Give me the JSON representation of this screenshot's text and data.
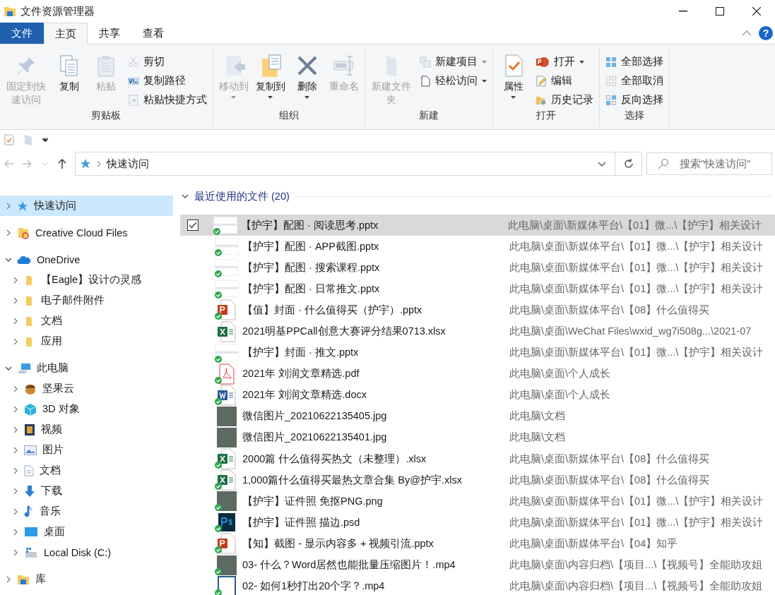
{
  "window": {
    "title": "文件资源管理器"
  },
  "ribbon": {
    "tabs": [
      {
        "label": "文件",
        "kind": "file",
        "selected": false
      },
      {
        "label": "主页",
        "kind": "tab",
        "selected": true
      },
      {
        "label": "共享",
        "kind": "tab",
        "selected": false
      },
      {
        "label": "查看",
        "kind": "tab",
        "selected": false
      }
    ],
    "help": "?",
    "groups": [
      {
        "label": "剪贴板",
        "items": [
          {
            "kind": "large",
            "label": "固定到快速访问",
            "disabled": true,
            "dropdown": false
          },
          {
            "kind": "large",
            "label": "复制",
            "disabled": false,
            "dropdown": false
          },
          {
            "kind": "large",
            "label": "粘贴",
            "disabled": true,
            "dropdown": false
          },
          {
            "kind": "small",
            "label": "剪切",
            "disabled": true,
            "dropdown": false
          },
          {
            "kind": "small",
            "label": "复制路径",
            "disabled": false,
            "dropdown": false
          },
          {
            "kind": "small",
            "label": "粘贴快捷方式",
            "disabled": true,
            "dropdown": false
          }
        ]
      },
      {
        "label": "组织",
        "items": [
          {
            "kind": "large",
            "label": "移动到",
            "disabled": true,
            "dropdown": true
          },
          {
            "kind": "large",
            "label": "复制到",
            "disabled": false,
            "dropdown": true
          },
          {
            "kind": "large",
            "label": "删除",
            "disabled": false,
            "dropdown": true
          },
          {
            "kind": "large",
            "label": "重命名",
            "disabled": true,
            "dropdown": false
          }
        ]
      },
      {
        "label": "新建",
        "items": [
          {
            "kind": "large",
            "label": "新建文件夹",
            "disabled": true,
            "dropdown": false
          },
          {
            "kind": "small",
            "label": "新建项目",
            "disabled": true,
            "dropdown": true
          },
          {
            "kind": "small",
            "label": "轻松访问",
            "disabled": false,
            "dropdown": true
          }
        ]
      },
      {
        "label": "打开",
        "items": [
          {
            "kind": "large",
            "label": "属性",
            "disabled": false,
            "dropdown": true
          },
          {
            "kind": "small",
            "label": "打开",
            "disabled": false,
            "dropdown": true
          },
          {
            "kind": "small",
            "label": "编辑",
            "disabled": false,
            "dropdown": false
          },
          {
            "kind": "small",
            "label": "历史记录",
            "disabled": false,
            "dropdown": false
          }
        ]
      },
      {
        "label": "选择",
        "items": [
          {
            "kind": "small",
            "label": "全部选择",
            "disabled": false,
            "dropdown": false
          },
          {
            "kind": "small",
            "label": "全部取消",
            "disabled": false,
            "dropdown": false
          },
          {
            "kind": "small",
            "label": "反向选择",
            "disabled": false,
            "dropdown": false
          }
        ]
      }
    ]
  },
  "address_bar": {
    "path": "快速访问",
    "search": {
      "placeholder": "搜索\"快速访问\""
    }
  },
  "sidebar": {
    "items": [
      {
        "label": "快速访问",
        "expanded": false,
        "selected": true
      },
      {
        "label": "Creative Cloud Files",
        "expanded": false,
        "selected": false
      },
      {
        "label": "OneDrive",
        "expanded": true,
        "selected": false,
        "children": [
          {
            "label": "【Eagle】设计の灵感",
            "expanded": false,
            "selected": false
          },
          {
            "label": "电子邮件附件",
            "expanded": false,
            "selected": false
          },
          {
            "label": "文档",
            "expanded": false,
            "selected": false
          },
          {
            "label": "应用",
            "expanded": false,
            "selected": false
          }
        ]
      },
      {
        "label": "此电脑",
        "expanded": true,
        "selected": false,
        "children": [
          {
            "label": "坚果云",
            "expanded": false,
            "selected": false
          },
          {
            "label": "3D 对象",
            "expanded": false,
            "selected": false
          },
          {
            "label": "视频",
            "expanded": false,
            "selected": false
          },
          {
            "label": "图片",
            "expanded": false,
            "selected": false
          },
          {
            "label": "文档",
            "expanded": false,
            "selected": false
          },
          {
            "label": "下载",
            "expanded": false,
            "selected": false
          },
          {
            "label": "音乐",
            "expanded": false,
            "selected": false
          },
          {
            "label": "桌面",
            "expanded": false,
            "selected": false
          },
          {
            "label": "Local Disk (C:)",
            "expanded": false,
            "selected": false
          }
        ]
      },
      {
        "label": "库",
        "expanded": false,
        "selected": false
      }
    ]
  },
  "recent": {
    "title": "最近使用的文件 (20)",
    "expanded": true,
    "files": [
      {
        "name": "【护宇】配图 · 阅读思考.pptx",
        "path": "此电脑\\桌面\\新媒体平台\\【01】微...\\【护宇】相关设计",
        "kind": "thumbnail",
        "synced": true,
        "selected": true
      },
      {
        "name": "【护宇】配图 · APP截图.pptx",
        "path": "此电脑\\桌面\\新媒体平台\\【01】微...\\【护宇】相关设计",
        "kind": "thumbnail",
        "synced": true,
        "selected": false
      },
      {
        "name": "【护宇】配图 · 搜索课程.pptx",
        "path": "此电脑\\桌面\\新媒体平台\\【01】微...\\【护宇】相关设计",
        "kind": "thumbnail",
        "synced": true,
        "selected": false
      },
      {
        "name": "【护宇】配图 · 日常推文.pptx",
        "path": "此电脑\\桌面\\新媒体平台\\【01】微...\\【护宇】相关设计",
        "kind": "thumbnail",
        "synced": true,
        "selected": false
      },
      {
        "name": "【值】封面 · 什么值得买（护宇）.pptx",
        "path": "此电脑\\桌面\\新媒体平台\\【08】什么值得买",
        "kind": "powerpoint",
        "synced": true,
        "selected": false
      },
      {
        "name": "2021明基PPCall创意大赛评分结果0713.xlsx",
        "path": "此电脑\\桌面\\WeChat Files\\wxid_wg7i508g...\\2021-07",
        "kind": "excel",
        "synced": false,
        "selected": false
      },
      {
        "name": "【护宇】封面 · 推文.pptx",
        "path": "此电脑\\桌面\\新媒体平台\\【01】微...\\【护宇】相关设计",
        "kind": "thumbnail",
        "synced": true,
        "selected": false
      },
      {
        "name": "2021年 刘润文章精选.pdf",
        "path": "此电脑\\桌面\\个人成长",
        "kind": "pdf",
        "synced": true,
        "selected": false
      },
      {
        "name": "2021年 刘润文章精选.docx",
        "path": "此电脑\\桌面\\个人成长",
        "kind": "word",
        "synced": true,
        "selected": false
      },
      {
        "name": "微信图片_20210622135405.jpg",
        "path": "此电脑\\文档",
        "kind": "photo",
        "synced": false,
        "selected": false
      },
      {
        "name": "微信图片_20210622135401.jpg",
        "path": "此电脑\\文档",
        "kind": "photo",
        "synced": false,
        "selected": false
      },
      {
        "name": "2000篇 什么值得买热文（未整理）.xlsx",
        "path": "此电脑\\桌面\\新媒体平台\\【08】什么值得买",
        "kind": "excel",
        "synced": true,
        "selected": false
      },
      {
        "name": "1,000篇什么值得买最热文章合集 By@护宇.xlsx",
        "path": "此电脑\\桌面\\新媒体平台\\【08】什么值得买",
        "kind": "excel",
        "synced": true,
        "selected": false
      },
      {
        "name": "【护宇】证件照 免抠PNG.png",
        "path": "此电脑\\桌面\\新媒体平台\\【01】微...\\【护宇】相关设计",
        "kind": "photo",
        "synced": true,
        "selected": false
      },
      {
        "name": "【护宇】证件照 描边.psd",
        "path": "此电脑\\桌面\\新媒体平台\\【01】微...\\【护宇】相关设计",
        "kind": "photoshop",
        "synced": true,
        "selected": false
      },
      {
        "name": "【知】截图 - 显示内容多 + 视频引流.pptx",
        "path": "此电脑\\桌面\\新媒体平台\\【04】知乎",
        "kind": "powerpoint",
        "synced": true,
        "selected": false
      },
      {
        "name": "03- 什么？Word居然也能批量压缩图片！.mp4",
        "path": "此电脑\\桌面\\内容归档\\【项目...\\【视频号】全能助攻姐",
        "kind": "photo",
        "synced": true,
        "selected": false
      },
      {
        "name": "02- 如何1秒打出20个字？.mp4",
        "path": "此电脑\\桌面\\内容归档\\【项目...\\【视频号】全能助攻姐",
        "kind": "video",
        "synced": true,
        "selected": false
      }
    ]
  }
}
